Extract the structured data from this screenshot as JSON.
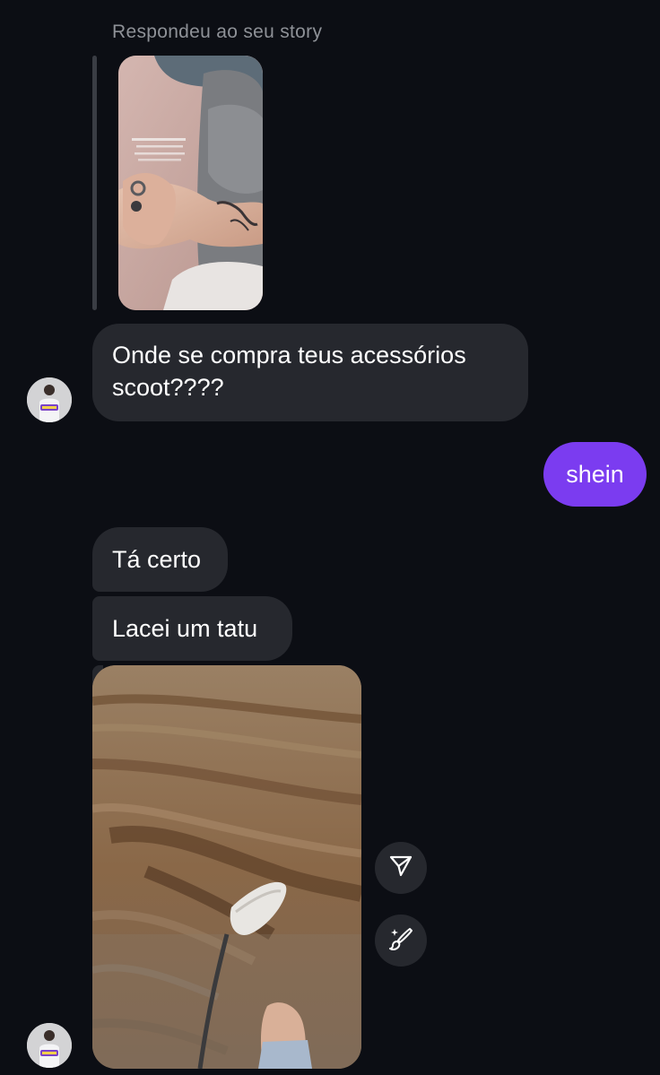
{
  "story_reply": {
    "label": "Respondeu ao seu story"
  },
  "messages": [
    {
      "from": "them",
      "text": "Onde se compra teus acessórios scoot????"
    },
    {
      "from": "me",
      "text": "shein"
    },
    {
      "from": "them",
      "text": "Tá certo"
    },
    {
      "from": "them",
      "text": "Lacei um tatu"
    }
  ],
  "media_actions": {
    "share_icon": "send-icon",
    "edit_icon": "magic-brush-icon"
  },
  "colors": {
    "background": "#0c0e14",
    "incoming_bubble": "#26282e",
    "outgoing_bubble": "#7b3cf0",
    "muted_text": "#8e9197"
  }
}
